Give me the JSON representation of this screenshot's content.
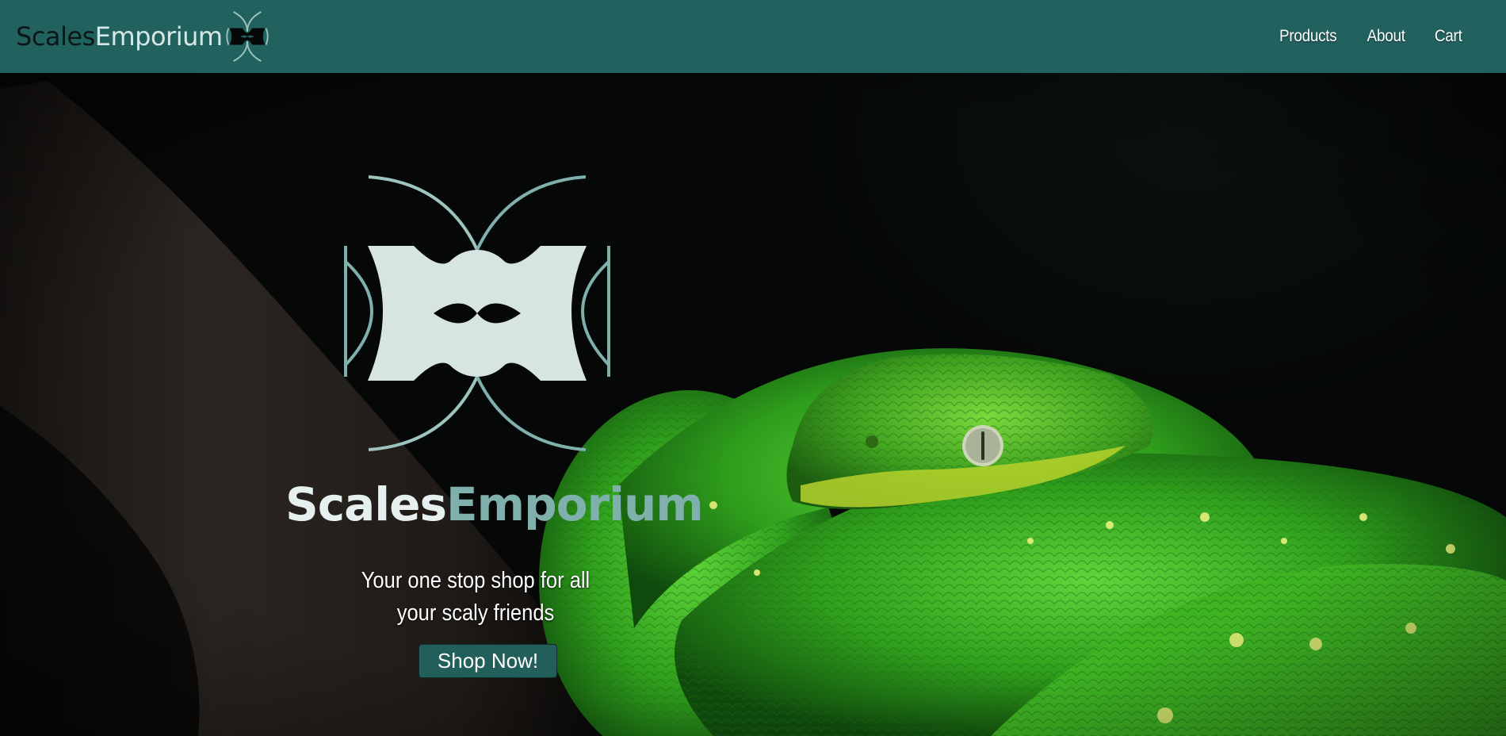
{
  "brand": {
    "name_part1": "Scales",
    "name_part2": "Emporium"
  },
  "nav": {
    "products": "Products",
    "about": "About",
    "cart": "Cart"
  },
  "hero": {
    "title_part1": "Scales",
    "title_part2": "Emporium",
    "tagline": "Your one stop shop for all your scaly friends",
    "cta": "Shop Now!",
    "background_image": "green tree python coiled on a branch"
  },
  "colors": {
    "header_bg": "#22625e",
    "accent_light": "#d6e7e4",
    "accent_teal": "#7fb0ac",
    "button_bg": "#225e5a",
    "page_bg": "#050807"
  }
}
